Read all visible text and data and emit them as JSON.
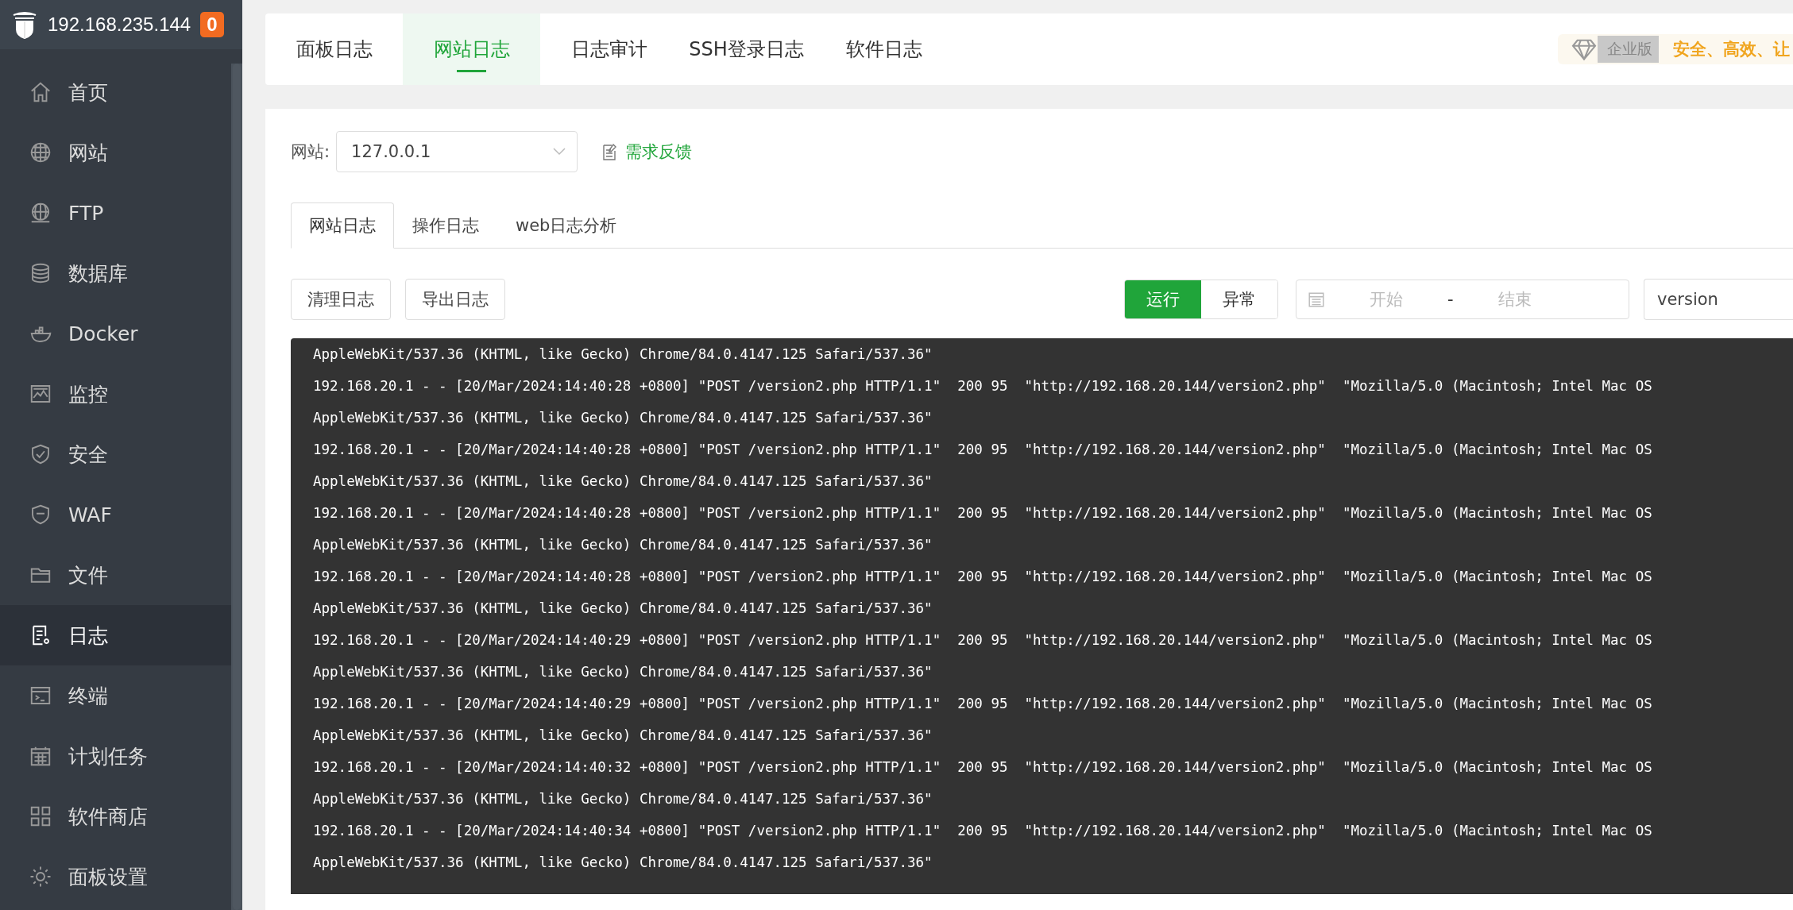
{
  "sidebar": {
    "host": "192.168.235.144",
    "badge": "0",
    "items": [
      {
        "label": "首页",
        "selected": false
      },
      {
        "label": "网站",
        "selected": false
      },
      {
        "label": "FTP",
        "selected": false
      },
      {
        "label": "数据库",
        "selected": false
      },
      {
        "label": "Docker",
        "selected": false
      },
      {
        "label": "监控",
        "selected": false
      },
      {
        "label": "安全",
        "selected": false
      },
      {
        "label": "WAF",
        "selected": false
      },
      {
        "label": "文件",
        "selected": false
      },
      {
        "label": "日志",
        "selected": true
      },
      {
        "label": "终端",
        "selected": false
      },
      {
        "label": "计划任务",
        "selected": false
      },
      {
        "label": "软件商店",
        "selected": false
      },
      {
        "label": "面板设置",
        "selected": false
      }
    ]
  },
  "top_tabs": [
    {
      "label": "面板日志",
      "selected": false
    },
    {
      "label": "网站日志",
      "selected": true
    },
    {
      "label": "日志审计",
      "selected": false
    },
    {
      "label": "SSH登录日志",
      "selected": false
    },
    {
      "label": "软件日志",
      "selected": false
    }
  ],
  "promo": {
    "edition": "企业版",
    "slogan": "安全、高效、让"
  },
  "site_filter": {
    "label": "网站:",
    "value": "127.0.0.1",
    "feedback": "需求反馈"
  },
  "sub_tabs": [
    {
      "label": "网站日志",
      "selected": true
    },
    {
      "label": "操作日志",
      "selected": false
    },
    {
      "label": "web日志分析",
      "selected": false
    }
  ],
  "actions": [
    "清理日志",
    "导出日志"
  ],
  "status_toggle": [
    {
      "label": "运行",
      "selected": true
    },
    {
      "label": "异常",
      "selected": false
    }
  ],
  "date_range": {
    "start_placeholder": "开始",
    "separator": "-",
    "end_placeholder": "结束"
  },
  "search": {
    "value": "version"
  },
  "log_lines": [
    "AppleWebKit/537.36 (KHTML, like Gecko) Chrome/84.0.4147.125 Safari/537.36\"",
    "192.168.20.1 - - [20/Mar/2024:14:40:28 +0800] \"POST /version2.php HTTP/1.1\"  200 95  \"http://192.168.20.144/version2.php\"  \"Mozilla/5.0 (Macintosh; Intel Mac OS",
    "AppleWebKit/537.36 (KHTML, like Gecko) Chrome/84.0.4147.125 Safari/537.36\"",
    "192.168.20.1 - - [20/Mar/2024:14:40:28 +0800] \"POST /version2.php HTTP/1.1\"  200 95  \"http://192.168.20.144/version2.php\"  \"Mozilla/5.0 (Macintosh; Intel Mac OS",
    "AppleWebKit/537.36 (KHTML, like Gecko) Chrome/84.0.4147.125 Safari/537.36\"",
    "192.168.20.1 - - [20/Mar/2024:14:40:28 +0800] \"POST /version2.php HTTP/1.1\"  200 95  \"http://192.168.20.144/version2.php\"  \"Mozilla/5.0 (Macintosh; Intel Mac OS",
    "AppleWebKit/537.36 (KHTML, like Gecko) Chrome/84.0.4147.125 Safari/537.36\"",
    "192.168.20.1 - - [20/Mar/2024:14:40:28 +0800] \"POST /version2.php HTTP/1.1\"  200 95  \"http://192.168.20.144/version2.php\"  \"Mozilla/5.0 (Macintosh; Intel Mac OS",
    "AppleWebKit/537.36 (KHTML, like Gecko) Chrome/84.0.4147.125 Safari/537.36\"",
    "192.168.20.1 - - [20/Mar/2024:14:40:29 +0800] \"POST /version2.php HTTP/1.1\"  200 95  \"http://192.168.20.144/version2.php\"  \"Mozilla/5.0 (Macintosh; Intel Mac OS",
    "AppleWebKit/537.36 (KHTML, like Gecko) Chrome/84.0.4147.125 Safari/537.36\"",
    "192.168.20.1 - - [20/Mar/2024:14:40:29 +0800] \"POST /version2.php HTTP/1.1\"  200 95  \"http://192.168.20.144/version2.php\"  \"Mozilla/5.0 (Macintosh; Intel Mac OS",
    "AppleWebKit/537.36 (KHTML, like Gecko) Chrome/84.0.4147.125 Safari/537.36\"",
    "192.168.20.1 - - [20/Mar/2024:14:40:32 +0800] \"POST /version2.php HTTP/1.1\"  200 95  \"http://192.168.20.144/version2.php\"  \"Mozilla/5.0 (Macintosh; Intel Mac OS",
    "AppleWebKit/537.36 (KHTML, like Gecko) Chrome/84.0.4147.125 Safari/537.36\"",
    "192.168.20.1 - - [20/Mar/2024:14:40:34 +0800] \"POST /version2.php HTTP/1.1\"  200 95  \"http://192.168.20.144/version2.php\"  \"Mozilla/5.0 (Macintosh; Intel Mac OS",
    "AppleWebKit/537.36 (KHTML, like Gecko) Chrome/84.0.4147.125 Safari/537.36\""
  ]
}
